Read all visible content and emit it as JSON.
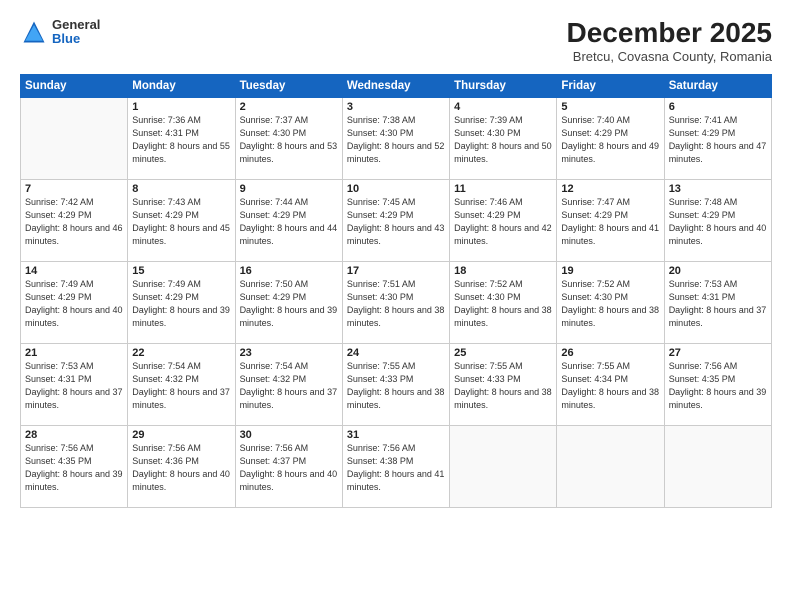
{
  "header": {
    "logo": {
      "general": "General",
      "blue": "Blue"
    },
    "title": "December 2025",
    "subtitle": "Bretcu, Covasna County, Romania"
  },
  "days_of_week": [
    "Sunday",
    "Monday",
    "Tuesday",
    "Wednesday",
    "Thursday",
    "Friday",
    "Saturday"
  ],
  "weeks": [
    [
      {
        "day": "",
        "sunrise": "",
        "sunset": "",
        "daylight": ""
      },
      {
        "day": "1",
        "sunrise": "Sunrise: 7:36 AM",
        "sunset": "Sunset: 4:31 PM",
        "daylight": "Daylight: 8 hours and 55 minutes."
      },
      {
        "day": "2",
        "sunrise": "Sunrise: 7:37 AM",
        "sunset": "Sunset: 4:30 PM",
        "daylight": "Daylight: 8 hours and 53 minutes."
      },
      {
        "day": "3",
        "sunrise": "Sunrise: 7:38 AM",
        "sunset": "Sunset: 4:30 PM",
        "daylight": "Daylight: 8 hours and 52 minutes."
      },
      {
        "day": "4",
        "sunrise": "Sunrise: 7:39 AM",
        "sunset": "Sunset: 4:30 PM",
        "daylight": "Daylight: 8 hours and 50 minutes."
      },
      {
        "day": "5",
        "sunrise": "Sunrise: 7:40 AM",
        "sunset": "Sunset: 4:29 PM",
        "daylight": "Daylight: 8 hours and 49 minutes."
      },
      {
        "day": "6",
        "sunrise": "Sunrise: 7:41 AM",
        "sunset": "Sunset: 4:29 PM",
        "daylight": "Daylight: 8 hours and 47 minutes."
      }
    ],
    [
      {
        "day": "7",
        "sunrise": "Sunrise: 7:42 AM",
        "sunset": "Sunset: 4:29 PM",
        "daylight": "Daylight: 8 hours and 46 minutes."
      },
      {
        "day": "8",
        "sunrise": "Sunrise: 7:43 AM",
        "sunset": "Sunset: 4:29 PM",
        "daylight": "Daylight: 8 hours and 45 minutes."
      },
      {
        "day": "9",
        "sunrise": "Sunrise: 7:44 AM",
        "sunset": "Sunset: 4:29 PM",
        "daylight": "Daylight: 8 hours and 44 minutes."
      },
      {
        "day": "10",
        "sunrise": "Sunrise: 7:45 AM",
        "sunset": "Sunset: 4:29 PM",
        "daylight": "Daylight: 8 hours and 43 minutes."
      },
      {
        "day": "11",
        "sunrise": "Sunrise: 7:46 AM",
        "sunset": "Sunset: 4:29 PM",
        "daylight": "Daylight: 8 hours and 42 minutes."
      },
      {
        "day": "12",
        "sunrise": "Sunrise: 7:47 AM",
        "sunset": "Sunset: 4:29 PM",
        "daylight": "Daylight: 8 hours and 41 minutes."
      },
      {
        "day": "13",
        "sunrise": "Sunrise: 7:48 AM",
        "sunset": "Sunset: 4:29 PM",
        "daylight": "Daylight: 8 hours and 40 minutes."
      }
    ],
    [
      {
        "day": "14",
        "sunrise": "Sunrise: 7:49 AM",
        "sunset": "Sunset: 4:29 PM",
        "daylight": "Daylight: 8 hours and 40 minutes."
      },
      {
        "day": "15",
        "sunrise": "Sunrise: 7:49 AM",
        "sunset": "Sunset: 4:29 PM",
        "daylight": "Daylight: 8 hours and 39 minutes."
      },
      {
        "day": "16",
        "sunrise": "Sunrise: 7:50 AM",
        "sunset": "Sunset: 4:29 PM",
        "daylight": "Daylight: 8 hours and 39 minutes."
      },
      {
        "day": "17",
        "sunrise": "Sunrise: 7:51 AM",
        "sunset": "Sunset: 4:30 PM",
        "daylight": "Daylight: 8 hours and 38 minutes."
      },
      {
        "day": "18",
        "sunrise": "Sunrise: 7:52 AM",
        "sunset": "Sunset: 4:30 PM",
        "daylight": "Daylight: 8 hours and 38 minutes."
      },
      {
        "day": "19",
        "sunrise": "Sunrise: 7:52 AM",
        "sunset": "Sunset: 4:30 PM",
        "daylight": "Daylight: 8 hours and 38 minutes."
      },
      {
        "day": "20",
        "sunrise": "Sunrise: 7:53 AM",
        "sunset": "Sunset: 4:31 PM",
        "daylight": "Daylight: 8 hours and 37 minutes."
      }
    ],
    [
      {
        "day": "21",
        "sunrise": "Sunrise: 7:53 AM",
        "sunset": "Sunset: 4:31 PM",
        "daylight": "Daylight: 8 hours and 37 minutes."
      },
      {
        "day": "22",
        "sunrise": "Sunrise: 7:54 AM",
        "sunset": "Sunset: 4:32 PM",
        "daylight": "Daylight: 8 hours and 37 minutes."
      },
      {
        "day": "23",
        "sunrise": "Sunrise: 7:54 AM",
        "sunset": "Sunset: 4:32 PM",
        "daylight": "Daylight: 8 hours and 37 minutes."
      },
      {
        "day": "24",
        "sunrise": "Sunrise: 7:55 AM",
        "sunset": "Sunset: 4:33 PM",
        "daylight": "Daylight: 8 hours and 38 minutes."
      },
      {
        "day": "25",
        "sunrise": "Sunrise: 7:55 AM",
        "sunset": "Sunset: 4:33 PM",
        "daylight": "Daylight: 8 hours and 38 minutes."
      },
      {
        "day": "26",
        "sunrise": "Sunrise: 7:55 AM",
        "sunset": "Sunset: 4:34 PM",
        "daylight": "Daylight: 8 hours and 38 minutes."
      },
      {
        "day": "27",
        "sunrise": "Sunrise: 7:56 AM",
        "sunset": "Sunset: 4:35 PM",
        "daylight": "Daylight: 8 hours and 39 minutes."
      }
    ],
    [
      {
        "day": "28",
        "sunrise": "Sunrise: 7:56 AM",
        "sunset": "Sunset: 4:35 PM",
        "daylight": "Daylight: 8 hours and 39 minutes."
      },
      {
        "day": "29",
        "sunrise": "Sunrise: 7:56 AM",
        "sunset": "Sunset: 4:36 PM",
        "daylight": "Daylight: 8 hours and 40 minutes."
      },
      {
        "day": "30",
        "sunrise": "Sunrise: 7:56 AM",
        "sunset": "Sunset: 4:37 PM",
        "daylight": "Daylight: 8 hours and 40 minutes."
      },
      {
        "day": "31",
        "sunrise": "Sunrise: 7:56 AM",
        "sunset": "Sunset: 4:38 PM",
        "daylight": "Daylight: 8 hours and 41 minutes."
      },
      {
        "day": "",
        "sunrise": "",
        "sunset": "",
        "daylight": ""
      },
      {
        "day": "",
        "sunrise": "",
        "sunset": "",
        "daylight": ""
      },
      {
        "day": "",
        "sunrise": "",
        "sunset": "",
        "daylight": ""
      }
    ]
  ]
}
